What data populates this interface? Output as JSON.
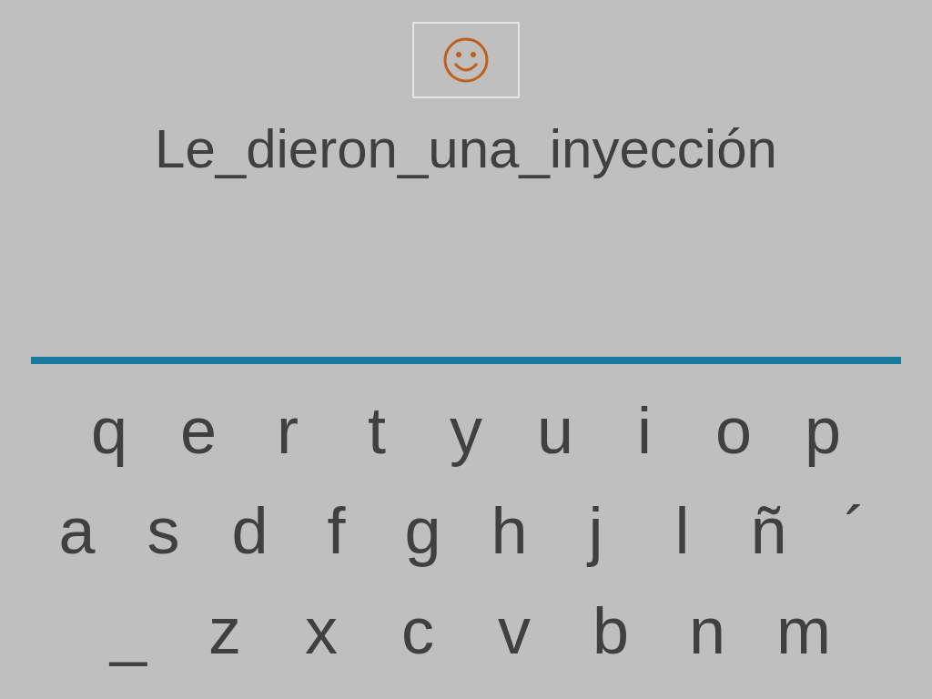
{
  "phrase": "Le_dieron_una_inyección",
  "keyboard_rows": [
    [
      "q",
      "e",
      "r",
      "t",
      "y",
      "u",
      "i",
      "o",
      "p"
    ],
    [
      "a",
      "s",
      "d",
      "f",
      "g",
      "h",
      "j",
      "l",
      "ñ",
      "´"
    ],
    [
      "_",
      "z",
      "x",
      "c",
      "v",
      "b",
      "n",
      "m"
    ]
  ]
}
